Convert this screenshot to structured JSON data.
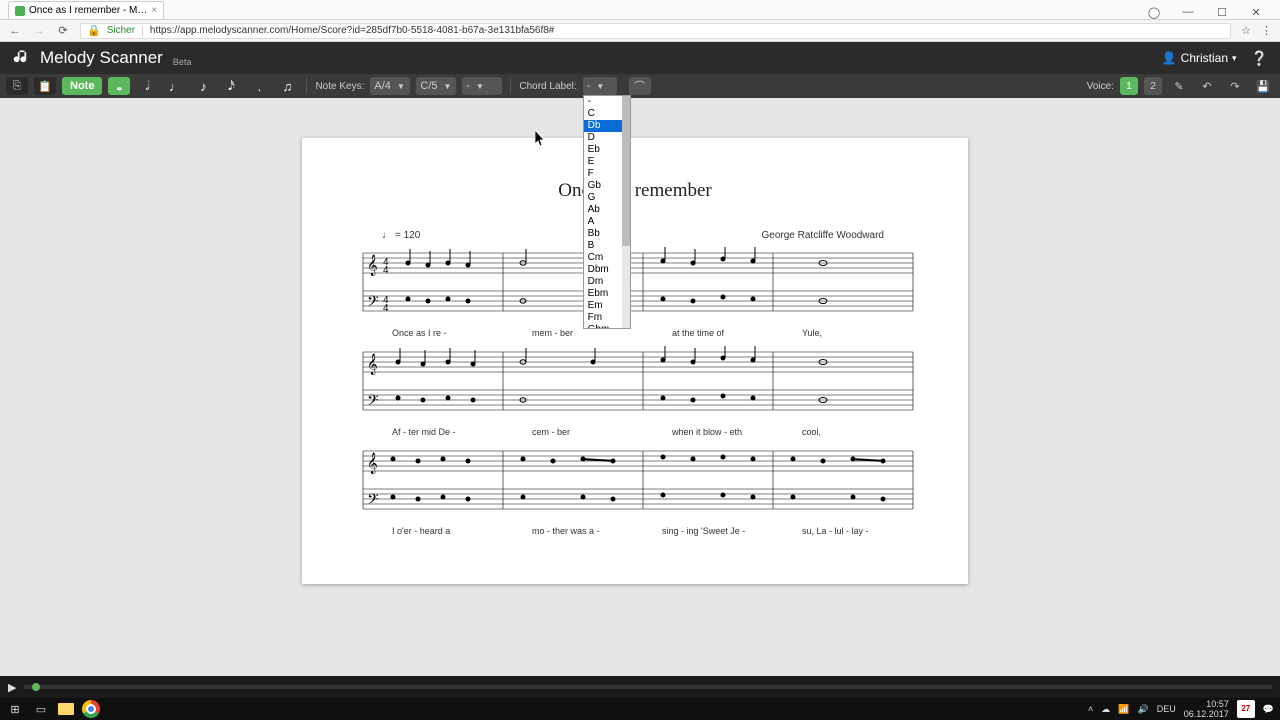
{
  "browser": {
    "tab_title": "Once as I remember - M…",
    "secure_label": "Sicher",
    "url": "https://app.melodyscanner.com/Home/Score?id=285df7b0-5518-4081-b67a-3e131bfa56f8#"
  },
  "app": {
    "title": "Melody Scanner",
    "beta": "Beta",
    "user": "Christian"
  },
  "toolbar": {
    "note_btn": "Note",
    "note_keys_label": "Note Keys:",
    "notekey1": "A/4",
    "notekey2": "C/5",
    "notekey3": "-",
    "chord_label_label": "Chord Label:",
    "chord_value": "-",
    "voice_label": "Voice:",
    "voice1": "1",
    "voice2": "2"
  },
  "dropdown": {
    "items": [
      "-",
      "C",
      "Db",
      "D",
      "Eb",
      "E",
      "F",
      "Gb",
      "G",
      "Ab",
      "A",
      "Bb",
      "B",
      "Cm",
      "Dbm",
      "Dm",
      "Ebm",
      "Em",
      "Fm",
      "Gbm"
    ],
    "highlight_index": 2
  },
  "score": {
    "title": "Once as I remember",
    "tempo": "= 120",
    "composer": "George Ratcliffe Woodward",
    "lyrics1": {
      "a": "Once as I re -",
      "b": "mem - ber",
      "c": "at the time of",
      "d": "Yule,"
    },
    "lyrics2": {
      "a": "Af - ter mid De -",
      "b": "cem - ber",
      "c": "when it blow - eth",
      "d": "cool,"
    },
    "lyrics3": {
      "a": "I o'er - heard a",
      "b": "mo - ther was a -",
      "c": "sing - ing 'Sweet Je -",
      "d": "su, La - lul - lay -"
    }
  },
  "taskbar": {
    "lang": "DEU",
    "time": "10:57",
    "date": "06.12.2017",
    "cal": "27"
  }
}
